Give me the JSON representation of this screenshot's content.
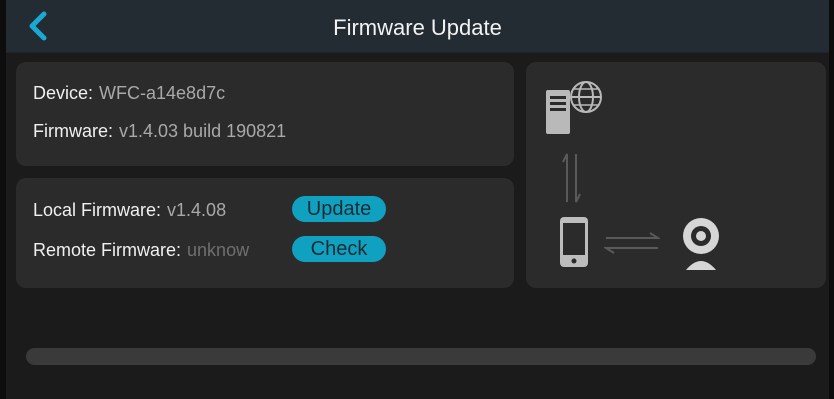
{
  "header": {
    "title": "Firmware Update",
    "back_icon": "chevron-left-icon"
  },
  "device_info": {
    "device_label": "Device:",
    "device_value": "WFC-a14e8d7c",
    "firmware_label": "Firmware:",
    "firmware_value": "v1.4.03 build 190821"
  },
  "update_panel": {
    "local_label": "Local Firmware:",
    "local_value": "v1.4.08",
    "update_button": "Update",
    "remote_label": "Remote Firmware:",
    "remote_value": "unknow",
    "check_button": "Check"
  },
  "diagram": {
    "icons": [
      "server-globe-icon",
      "vertical-arrows-icon",
      "phone-icon",
      "horizontal-arrows-icon",
      "camera-icon"
    ]
  },
  "progress": {
    "value": 0
  },
  "colors": {
    "accent": "#10a0c0",
    "titlebar": "#232b33",
    "card": "#2b2b2b",
    "background": "#1b1b1b"
  }
}
